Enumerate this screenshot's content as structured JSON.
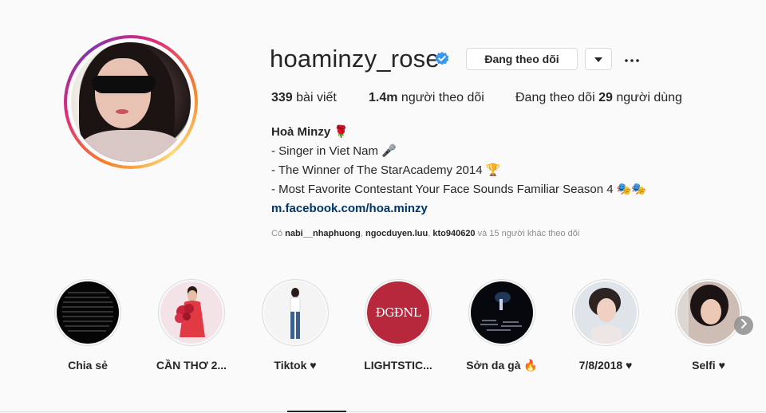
{
  "profile": {
    "username": "hoaminzy_rose",
    "following_button": "Đang theo dõi",
    "stats": {
      "posts_count": "339",
      "posts_label": "bài viết",
      "followers_count": "1.4m",
      "followers_label": "người theo dõi",
      "following_prefix": "Đang theo dõi",
      "following_count": "29",
      "following_suffix": "người dùng"
    },
    "bio": {
      "name": "Hoà Minzy 🌹",
      "lines": [
        "- Singer in Viet Nam 🎤",
        "- The Winner of The StarAcademy 2014 🏆",
        "- Most Favorite Contestant Your Face Sounds Familiar Season 4 🎭🎭"
      ],
      "link": "m.facebook.com/hoa.minzy"
    },
    "followed_by": {
      "prefix": "Có",
      "user1": "nabi__nhaphuong",
      "sep1": ",",
      "user2": "ngocduyen.luu",
      "sep2": ",",
      "user3": "kto940620",
      "suffix": "và 15 người khác theo dõi"
    }
  },
  "highlights": [
    {
      "label": "Chia sẻ"
    },
    {
      "label": "CẦN THƠ 2..."
    },
    {
      "label": "Tiktok ♥"
    },
    {
      "label": "LIGHTSTIC...",
      "badge_text": "ĐGĐNL"
    },
    {
      "label": "Sởn da gà 🔥"
    },
    {
      "label": "7/8/2018 ♥"
    },
    {
      "label": "Selfi ♥"
    }
  ],
  "colors": {
    "verified": "#3897f0",
    "text": "#262626",
    "muted": "#8e8e8e",
    "border": "#dbdbdb",
    "link": "#003569"
  },
  "icons": {
    "verified": "verified-badge-icon",
    "dropdown": "caret-down-icon",
    "more": "more-options-icon",
    "next": "chevron-right-icon"
  }
}
